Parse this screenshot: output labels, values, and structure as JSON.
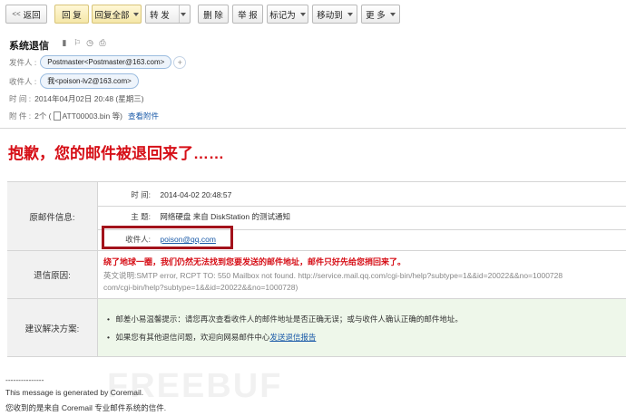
{
  "toolbar": {
    "back": "返回",
    "reply": "回 复",
    "reply_all": "回复全部",
    "forward": "转 发",
    "delete": "删 除",
    "report": "举 报",
    "mark_as": "标记为",
    "move_to": "移动到",
    "more": "更 多"
  },
  "header": {
    "subject": "系统退信",
    "from_label": "发件人 :",
    "from_value": "Postmaster<Postmaster@163.com>",
    "to_label": "收件人 :",
    "to_value": "我<poison-lv2@163.com>",
    "time_label": "时   间 :",
    "time_value": "2014年04月02日 20:48 (星期三)",
    "attach_label": "附   件 :",
    "attach_count": "2个 (",
    "attach_name": "ATT00003.bin 等)",
    "attach_link": "查看附件"
  },
  "headline": "抱歉，您的邮件被退回来了……",
  "info": {
    "section_label": "原邮件信息:",
    "time_label": "时    间:",
    "time_value": "2014-04-02 20:48:57",
    "subject_label": "主    题:",
    "subject_value": "网络硬盘 来自 DiskStation 的测试通知",
    "recipient_label": "收件人:",
    "recipient_value": "poison@qq.com"
  },
  "bounce": {
    "label": "退信原因:",
    "reason_cn": "绕了地球一圈，我们仍然无法找到您要发送的邮件地址，邮件只好先给您捎回来了。",
    "reason_en_1": "英文说明:SMTP error, RCPT TO: 550 Mailbox not found. http://service.mail.qq.com/cgi-bin/help?subtype=1&&id=20022&&no=1000728",
    "reason_en_2": "com/cgi-bin/help?subtype=1&&id=20022&&no=1000728)"
  },
  "advice": {
    "label": "建议解决方案:",
    "item1": "邮差小易温馨提示：请您再次查看收件人的邮件地址是否正确无误；或与收件人确认正确的邮件地址。",
    "item2_prefix": "如果您有其他退信问题，欢迎向网易邮件中心",
    "item2_link": "发送退信报告"
  },
  "footer": {
    "sep": "---------------",
    "line1": "This message is generated by Coremail.",
    "line2": "您收到的是来自 Coremail 专业邮件系统的信件."
  },
  "watermark": "FREEBUF",
  "colors": {
    "accent_red": "#d60f17",
    "box_red": "#a3121b",
    "link_blue": "#1a5aa8"
  }
}
